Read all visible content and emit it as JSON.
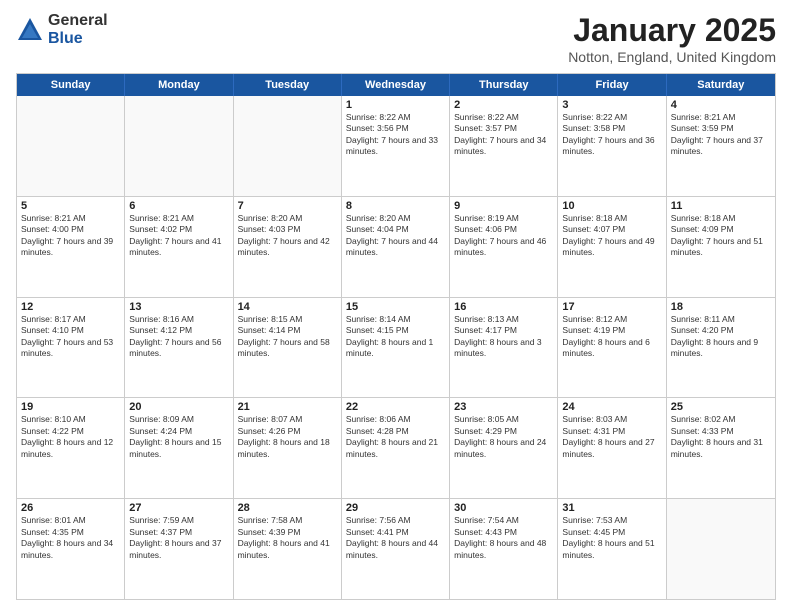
{
  "logo": {
    "general": "General",
    "blue": "Blue"
  },
  "header": {
    "title": "January 2025",
    "location": "Notton, England, United Kingdom"
  },
  "days_of_week": [
    "Sunday",
    "Monday",
    "Tuesday",
    "Wednesday",
    "Thursday",
    "Friday",
    "Saturday"
  ],
  "weeks": [
    [
      {
        "day": "",
        "sunrise": "",
        "sunset": "",
        "daylight": ""
      },
      {
        "day": "",
        "sunrise": "",
        "sunset": "",
        "daylight": ""
      },
      {
        "day": "",
        "sunrise": "",
        "sunset": "",
        "daylight": ""
      },
      {
        "day": "1",
        "sunrise": "Sunrise: 8:22 AM",
        "sunset": "Sunset: 3:56 PM",
        "daylight": "Daylight: 7 hours and 33 minutes."
      },
      {
        "day": "2",
        "sunrise": "Sunrise: 8:22 AM",
        "sunset": "Sunset: 3:57 PM",
        "daylight": "Daylight: 7 hours and 34 minutes."
      },
      {
        "day": "3",
        "sunrise": "Sunrise: 8:22 AM",
        "sunset": "Sunset: 3:58 PM",
        "daylight": "Daylight: 7 hours and 36 minutes."
      },
      {
        "day": "4",
        "sunrise": "Sunrise: 8:21 AM",
        "sunset": "Sunset: 3:59 PM",
        "daylight": "Daylight: 7 hours and 37 minutes."
      }
    ],
    [
      {
        "day": "5",
        "sunrise": "Sunrise: 8:21 AM",
        "sunset": "Sunset: 4:00 PM",
        "daylight": "Daylight: 7 hours and 39 minutes."
      },
      {
        "day": "6",
        "sunrise": "Sunrise: 8:21 AM",
        "sunset": "Sunset: 4:02 PM",
        "daylight": "Daylight: 7 hours and 41 minutes."
      },
      {
        "day": "7",
        "sunrise": "Sunrise: 8:20 AM",
        "sunset": "Sunset: 4:03 PM",
        "daylight": "Daylight: 7 hours and 42 minutes."
      },
      {
        "day": "8",
        "sunrise": "Sunrise: 8:20 AM",
        "sunset": "Sunset: 4:04 PM",
        "daylight": "Daylight: 7 hours and 44 minutes."
      },
      {
        "day": "9",
        "sunrise": "Sunrise: 8:19 AM",
        "sunset": "Sunset: 4:06 PM",
        "daylight": "Daylight: 7 hours and 46 minutes."
      },
      {
        "day": "10",
        "sunrise": "Sunrise: 8:18 AM",
        "sunset": "Sunset: 4:07 PM",
        "daylight": "Daylight: 7 hours and 49 minutes."
      },
      {
        "day": "11",
        "sunrise": "Sunrise: 8:18 AM",
        "sunset": "Sunset: 4:09 PM",
        "daylight": "Daylight: 7 hours and 51 minutes."
      }
    ],
    [
      {
        "day": "12",
        "sunrise": "Sunrise: 8:17 AM",
        "sunset": "Sunset: 4:10 PM",
        "daylight": "Daylight: 7 hours and 53 minutes."
      },
      {
        "day": "13",
        "sunrise": "Sunrise: 8:16 AM",
        "sunset": "Sunset: 4:12 PM",
        "daylight": "Daylight: 7 hours and 56 minutes."
      },
      {
        "day": "14",
        "sunrise": "Sunrise: 8:15 AM",
        "sunset": "Sunset: 4:14 PM",
        "daylight": "Daylight: 7 hours and 58 minutes."
      },
      {
        "day": "15",
        "sunrise": "Sunrise: 8:14 AM",
        "sunset": "Sunset: 4:15 PM",
        "daylight": "Daylight: 8 hours and 1 minute."
      },
      {
        "day": "16",
        "sunrise": "Sunrise: 8:13 AM",
        "sunset": "Sunset: 4:17 PM",
        "daylight": "Daylight: 8 hours and 3 minutes."
      },
      {
        "day": "17",
        "sunrise": "Sunrise: 8:12 AM",
        "sunset": "Sunset: 4:19 PM",
        "daylight": "Daylight: 8 hours and 6 minutes."
      },
      {
        "day": "18",
        "sunrise": "Sunrise: 8:11 AM",
        "sunset": "Sunset: 4:20 PM",
        "daylight": "Daylight: 8 hours and 9 minutes."
      }
    ],
    [
      {
        "day": "19",
        "sunrise": "Sunrise: 8:10 AM",
        "sunset": "Sunset: 4:22 PM",
        "daylight": "Daylight: 8 hours and 12 minutes."
      },
      {
        "day": "20",
        "sunrise": "Sunrise: 8:09 AM",
        "sunset": "Sunset: 4:24 PM",
        "daylight": "Daylight: 8 hours and 15 minutes."
      },
      {
        "day": "21",
        "sunrise": "Sunrise: 8:07 AM",
        "sunset": "Sunset: 4:26 PM",
        "daylight": "Daylight: 8 hours and 18 minutes."
      },
      {
        "day": "22",
        "sunrise": "Sunrise: 8:06 AM",
        "sunset": "Sunset: 4:28 PM",
        "daylight": "Daylight: 8 hours and 21 minutes."
      },
      {
        "day": "23",
        "sunrise": "Sunrise: 8:05 AM",
        "sunset": "Sunset: 4:29 PM",
        "daylight": "Daylight: 8 hours and 24 minutes."
      },
      {
        "day": "24",
        "sunrise": "Sunrise: 8:03 AM",
        "sunset": "Sunset: 4:31 PM",
        "daylight": "Daylight: 8 hours and 27 minutes."
      },
      {
        "day": "25",
        "sunrise": "Sunrise: 8:02 AM",
        "sunset": "Sunset: 4:33 PM",
        "daylight": "Daylight: 8 hours and 31 minutes."
      }
    ],
    [
      {
        "day": "26",
        "sunrise": "Sunrise: 8:01 AM",
        "sunset": "Sunset: 4:35 PM",
        "daylight": "Daylight: 8 hours and 34 minutes."
      },
      {
        "day": "27",
        "sunrise": "Sunrise: 7:59 AM",
        "sunset": "Sunset: 4:37 PM",
        "daylight": "Daylight: 8 hours and 37 minutes."
      },
      {
        "day": "28",
        "sunrise": "Sunrise: 7:58 AM",
        "sunset": "Sunset: 4:39 PM",
        "daylight": "Daylight: 8 hours and 41 minutes."
      },
      {
        "day": "29",
        "sunrise": "Sunrise: 7:56 AM",
        "sunset": "Sunset: 4:41 PM",
        "daylight": "Daylight: 8 hours and 44 minutes."
      },
      {
        "day": "30",
        "sunrise": "Sunrise: 7:54 AM",
        "sunset": "Sunset: 4:43 PM",
        "daylight": "Daylight: 8 hours and 48 minutes."
      },
      {
        "day": "31",
        "sunrise": "Sunrise: 7:53 AM",
        "sunset": "Sunset: 4:45 PM",
        "daylight": "Daylight: 8 hours and 51 minutes."
      },
      {
        "day": "",
        "sunrise": "",
        "sunset": "",
        "daylight": ""
      }
    ]
  ]
}
